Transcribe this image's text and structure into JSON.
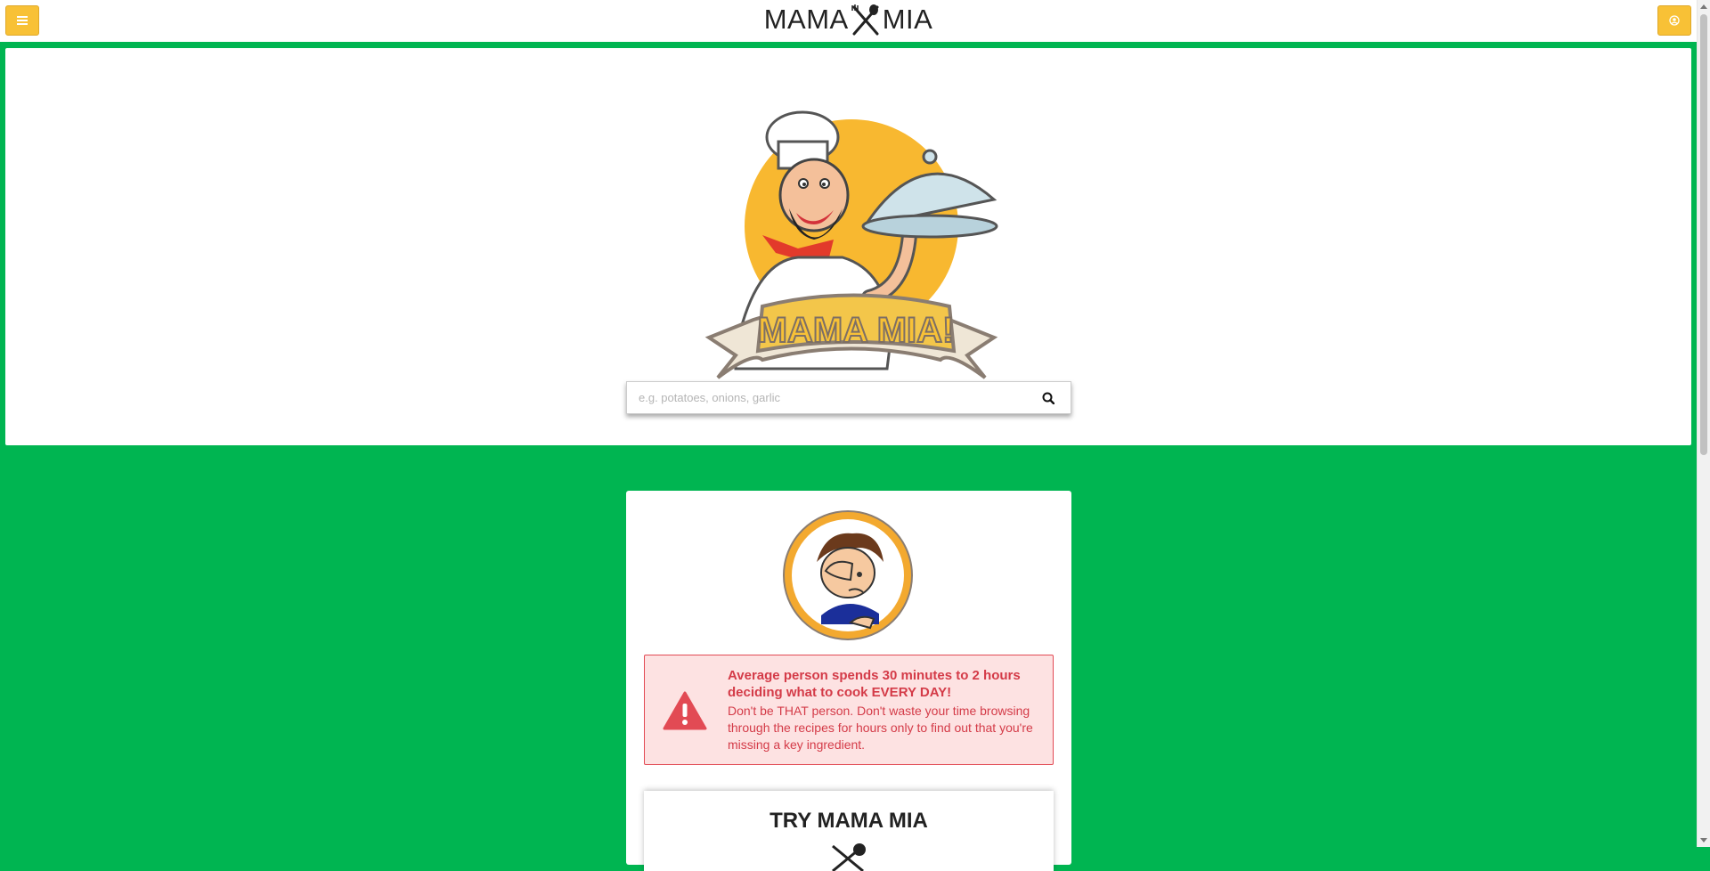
{
  "header": {
    "brand_left": "MAMA",
    "brand_right": "MIA",
    "menu_icon": "hamburger-icon",
    "user_icon": "user-icon",
    "accent_color": "#f8c136"
  },
  "hero": {
    "logo_text": "MAMA MIA!",
    "search": {
      "placeholder": "e.g. potatoes, onions, garlic",
      "value": "",
      "button_icon": "search-icon"
    }
  },
  "card": {
    "alert": {
      "headline": "Average person spends 30 minutes to 2 hours deciding what to cook EVERY DAY!",
      "body": "Don't be THAT person. Don't waste your time browsing through the recipes for hours only to find out that you're missing a key ingredient.",
      "icon": "warning-icon"
    },
    "try_title": "TRY MAMA MIA"
  },
  "colors": {
    "background_green": "#00b551",
    "alert_red": "#d43b48",
    "alert_bg": "#fde2e2"
  }
}
